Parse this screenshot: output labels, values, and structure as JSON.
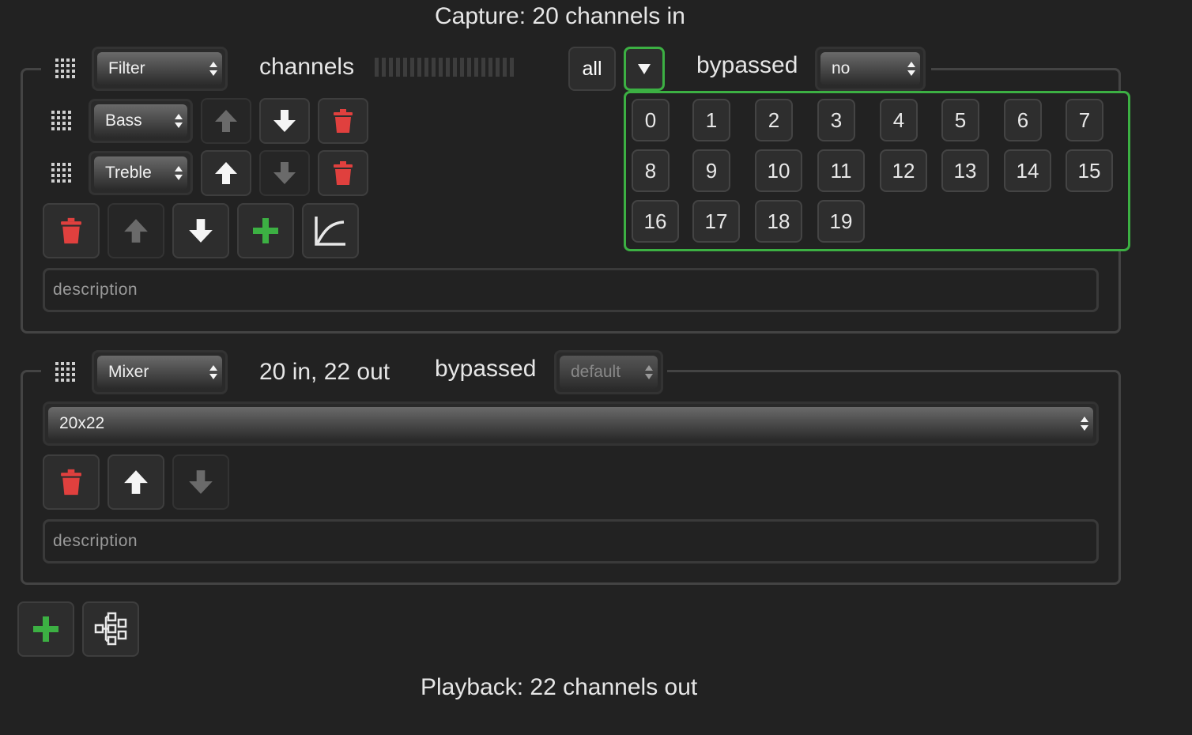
{
  "capture_label": "Capture: 20 channels in",
  "playback_label": "Playback: 22 channels out",
  "filter_step": {
    "type": "Filter",
    "channels_label": "channels",
    "all_label": "all",
    "bypassed_label": "bypassed",
    "bypassed_value": "no",
    "filters": [
      {
        "name": "Bass"
      },
      {
        "name": "Treble"
      }
    ],
    "channel_options": [
      "0",
      "1",
      "2",
      "3",
      "4",
      "5",
      "6",
      "7",
      "8",
      "9",
      "10",
      "11",
      "12",
      "13",
      "14",
      "15",
      "16",
      "17",
      "18",
      "19"
    ],
    "description_placeholder": "description",
    "colors": {
      "accent": "#3cb043",
      "delete": "#e0403e",
      "add": "#3cb043"
    }
  },
  "mixer_step": {
    "type": "Mixer",
    "io_label": "20 in, 22 out",
    "bypassed_label": "bypassed",
    "bypassed_value": "default",
    "mixer_value": "20x22",
    "description_placeholder": "description"
  },
  "icons": [
    "drag-handle-icon",
    "chevron-down-icon",
    "arrow-up-icon",
    "arrow-down-icon",
    "trash-icon",
    "plus-icon",
    "curve-icon",
    "pipeline-icon"
  ]
}
